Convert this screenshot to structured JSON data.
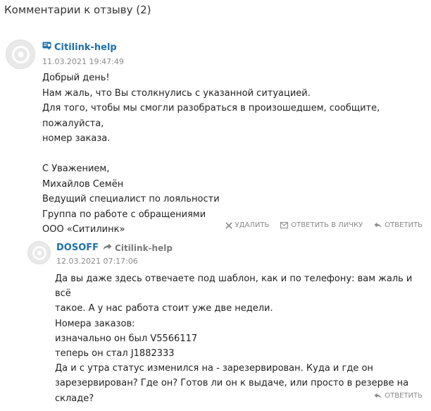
{
  "section": {
    "title": "Комментарии к отзыву (2)"
  },
  "comments": [
    {
      "author": "Citilink-help",
      "author_icon": "verified-badge-icon",
      "timestamp": "11.03.2021 19:47:49",
      "lines": [
        "Добрый день!",
        "Нам жаль, что Вы столкнулись с указанной ситуацией.",
        "Для того, чтобы мы смогли разобраться в произошедшем, сообщите, пожалуйста,",
        "номер заказа.",
        "",
        "С Уважением,",
        "Михайлов Семён",
        "Ведущий специалист по лояльности",
        "Группа по работе с обращениями",
        "ООО «Ситилинк»"
      ],
      "actions": {
        "delete": "УДАЛИТЬ",
        "reply_private": "ОТВЕТИТЬ В ЛИЧКУ",
        "reply": "ОТВЕТИТЬ"
      }
    },
    {
      "author": "DOSOFF",
      "reply_to": "Citilink-help",
      "timestamp": "12.03.2021 07:17:06",
      "lines": [
        "Да вы даже здесь отвечаете под шаблон, как и по телефону: вам жаль и всё",
        "такое. А у нас работа стоит уже две недели.",
        "Номера заказов:",
        "изначально он был V5566117",
        "теперь он стал J1882333",
        "Да и с утра статус изменился на - зарезервирован. Куда и где он",
        "зарезервирован? Где он? Готов ли он к выдаче, или просто в резерве на",
        "складе?"
      ],
      "actions": {
        "reply": "ОТВЕТИТЬ"
      }
    }
  ],
  "colors": {
    "author": "#1f6fa8",
    "meta": "#8a8a8a",
    "text": "#222222"
  }
}
